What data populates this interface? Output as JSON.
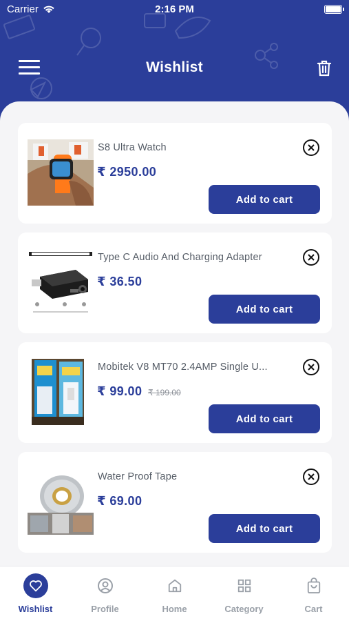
{
  "status_bar": {
    "carrier": "Carrier",
    "time": "2:16 PM"
  },
  "header": {
    "title": "Wishlist"
  },
  "wishlist": [
    {
      "name": "S8 Ultra Watch",
      "price": "₹ 2950.00",
      "old_price": "",
      "button": "Add to cart",
      "image": "smartwatch-photo"
    },
    {
      "name": "Type C Audio And Charging Adapter",
      "price": "₹ 36.50",
      "old_price": "",
      "button": "Add to cart",
      "image": "adapter-photo"
    },
    {
      "name": "Mobitek V8 MT70 2.4AMP Single U...",
      "price": "₹ 99.00",
      "old_price": "₹ 199.00",
      "button": "Add to cart",
      "image": "charger-box-photo"
    },
    {
      "name": "Water Proof Tape",
      "price": "₹ 69.00",
      "old_price": "",
      "button": "Add to cart",
      "image": "tape-photo"
    }
  ],
  "tabs": [
    {
      "label": "Wishlist",
      "icon": "heart-icon",
      "active": true
    },
    {
      "label": "Profile",
      "icon": "user-icon",
      "active": false
    },
    {
      "label": "Home",
      "icon": "home-icon",
      "active": false
    },
    {
      "label": "Category",
      "icon": "grid-icon",
      "active": false
    },
    {
      "label": "Cart",
      "icon": "bag-icon",
      "active": false
    }
  ],
  "colors": {
    "primary": "#2b3e9a",
    "background": "#f5f5f7",
    "inactive": "#9aa0a8"
  }
}
